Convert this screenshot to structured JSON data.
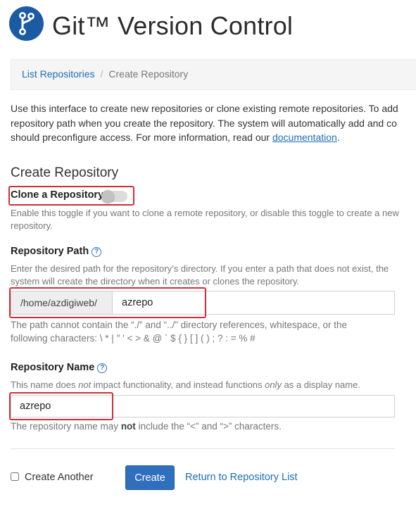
{
  "header": {
    "title": "Git™ Version Control",
    "logo_icon": "git-branch-icon",
    "logo_color": "#1b5ba4"
  },
  "breadcrumb": {
    "items": [
      "List Repositories",
      "Create Repository"
    ],
    "separator": "/"
  },
  "intro": {
    "line1": "Use this interface to create new repositories or clone existing remote repositories. To add",
    "line2": "repository path when you create the repository. The system will automatically add and co",
    "line3_prefix": "should preconfigure access. For more information, read our ",
    "link": "documentation",
    "line3_suffix": "."
  },
  "form": {
    "section_title": "Create Repository",
    "clone": {
      "label": "Clone a Repository",
      "enabled": false,
      "help": "Enable this toggle if you want to clone a remote repository, or disable this toggle to create a new repository."
    },
    "path": {
      "label": "Repository Path",
      "help_icon": "question-circle-icon",
      "help": "Enter the desired path for the repository’s directory. If you enter a path that does not exist, the system will create the directory when it creates or clones the repository.",
      "prefix": "/home/azdigiweb/",
      "value": "azrepo",
      "note_line1": "The path cannot contain the “./” and “../” directory references, whitespace, or the",
      "note_line2": "following characters: \\ * | \" ' < > & @ ` $ { } [ ] ( ) ; ? : = % #"
    },
    "name": {
      "label": "Repository Name",
      "help_icon": "question-circle-icon",
      "help_a": "This name does ",
      "help_em1": "not",
      "help_b": " impact functionality, and instead functions ",
      "help_em2": "only",
      "help_c": " as a display name.",
      "value": "azrepo",
      "note_a": "The repository name may ",
      "note_bold": "not",
      "note_b": " include the “<” and “>” characters."
    },
    "create_another_label": "Create Another",
    "create_button": "Create",
    "return_link": "Return to Repository List"
  },
  "colors": {
    "accent": "#2f6fbd",
    "link": "#1b6fb8",
    "highlight": "#cc2f3a"
  }
}
